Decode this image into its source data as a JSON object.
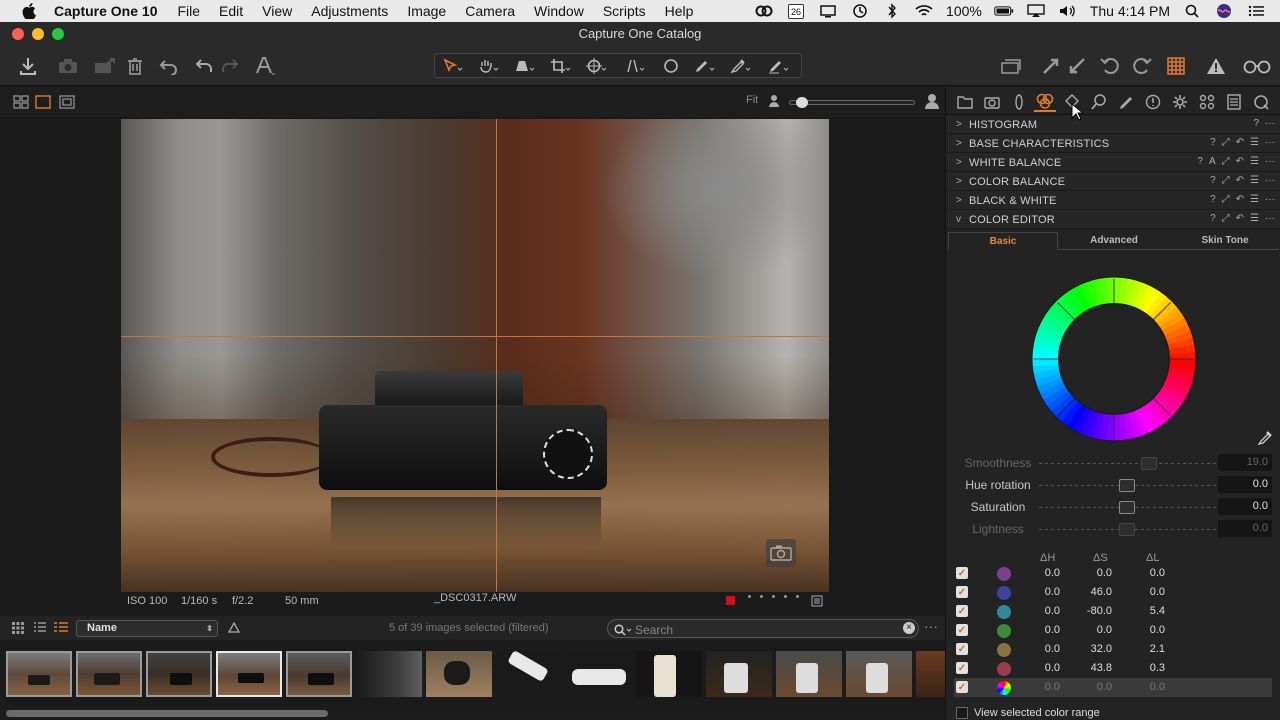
{
  "menubar": {
    "app_name": "Capture One 10",
    "items": [
      "File",
      "Edit",
      "View",
      "Adjustments",
      "Image",
      "Camera",
      "Window",
      "Scripts",
      "Help"
    ],
    "calendar_day": "26",
    "battery": "100%",
    "clock": "Thu 4:14 PM"
  },
  "window": {
    "title": "Capture One Catalog"
  },
  "viewer": {
    "fit_label": "Fit",
    "zoom_level": 0.1,
    "info": {
      "iso": "ISO 100",
      "shutter": "1/160 s",
      "aperture": "f/2.2",
      "focal": "50 mm",
      "filename": "_DSC0317.ARW"
    }
  },
  "browser": {
    "sort_label": "Name",
    "count_text": "5 of 39 images selected (filtered)",
    "search_placeholder": "Search"
  },
  "panel": {
    "sections": [
      {
        "name": "HISTOGRAM",
        "expanded": false
      },
      {
        "name": "BASE CHARACTERISTICS",
        "expanded": false
      },
      {
        "name": "WHITE BALANCE",
        "expanded": false
      },
      {
        "name": "COLOR BALANCE",
        "expanded": false
      },
      {
        "name": "BLACK & WHITE",
        "expanded": false
      },
      {
        "name": "COLOR EDITOR",
        "expanded": true
      }
    ],
    "color_editor": {
      "tabs": [
        "Basic",
        "Advanced",
        "Skin Tone"
      ],
      "active_tab": "Basic",
      "sliders": [
        {
          "label": "Smoothness",
          "value": "19.0",
          "enabled": false
        },
        {
          "label": "Hue rotation",
          "value": "0.0",
          "enabled": true
        },
        {
          "label": "Saturation",
          "value": "0.0",
          "enabled": true
        },
        {
          "label": "Lightness",
          "value": "0.0",
          "enabled": false
        }
      ],
      "delta_headers": [
        "ΔH",
        "ΔS",
        "ΔL"
      ],
      "rows": [
        {
          "color": "#7b3f8f",
          "dh": "0.0",
          "ds": "0.0",
          "dl": "0.0",
          "checked": true,
          "selected": false
        },
        {
          "color": "#3c44a0",
          "dh": "0.0",
          "ds": "46.0",
          "dl": "0.0",
          "checked": true,
          "selected": false
        },
        {
          "color": "#2f8a9a",
          "dh": "0.0",
          "ds": "-80.0",
          "dl": "5.4",
          "checked": true,
          "selected": false
        },
        {
          "color": "#3f8a3a",
          "dh": "0.0",
          "ds": "0.0",
          "dl": "0.0",
          "checked": true,
          "selected": false
        },
        {
          "color": "#8a7240",
          "dh": "0.0",
          "ds": "32.0",
          "dl": "2.1",
          "checked": true,
          "selected": false
        },
        {
          "color": "#9a3a50",
          "dh": "0.0",
          "ds": "43.8",
          "dl": "0.3",
          "checked": true,
          "selected": false
        },
        {
          "color": "rainbow",
          "dh": "0.0",
          "ds": "0.0",
          "dl": "0.0",
          "checked": true,
          "selected": true
        }
      ],
      "footer_checkbox": "View selected color range"
    }
  },
  "colors": {
    "accent": "#e07a30",
    "guide": "#c4743c",
    "background": "#1c1c1c"
  }
}
